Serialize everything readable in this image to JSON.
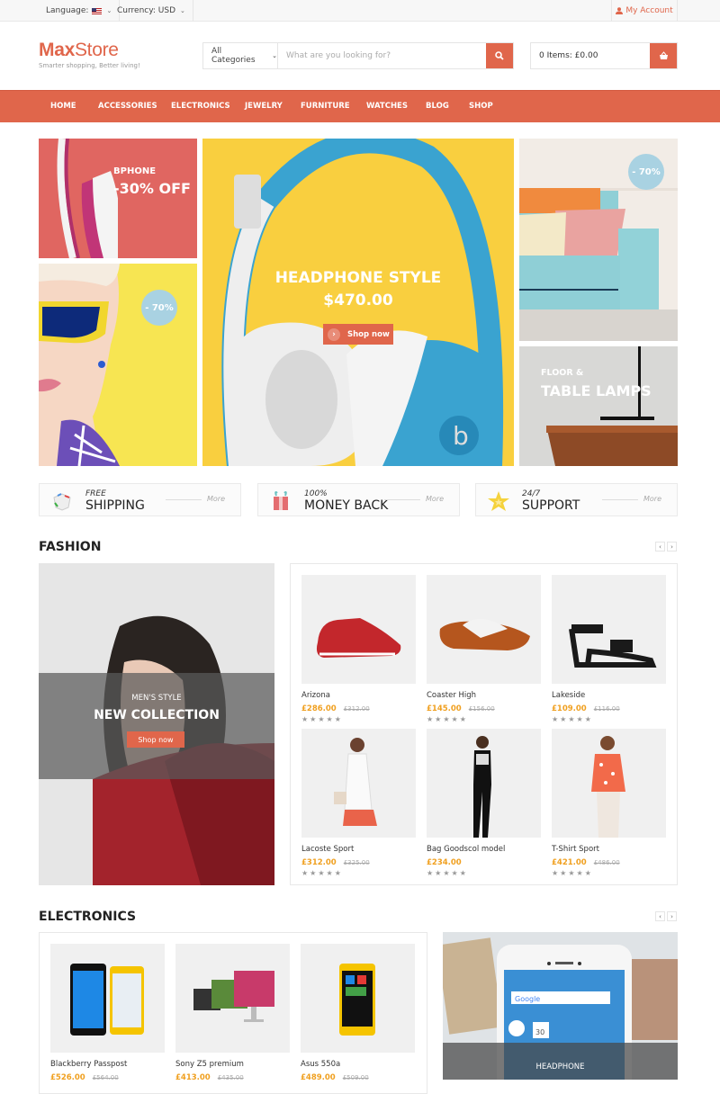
{
  "topbar": {
    "language_label": "Language:",
    "language_flag": "us-flag",
    "currency_label": "Currency: USD",
    "account_label": "My Account"
  },
  "header": {
    "logo_bold": "Max",
    "logo_rest": "Store",
    "tagline": "Smarter shopping, Better living!",
    "category_select": "All Categories",
    "search_placeholder": "What are you looking for?",
    "search_value": "",
    "cart_label": "0 Items: £0.00"
  },
  "nav": {
    "items": [
      "HOME",
      "ACCESSORIES",
      "ELECTRONICS",
      "JEWELRY",
      "FURNITURE",
      "WATCHES",
      "BLOG",
      "SHOP"
    ]
  },
  "banners": {
    "bphone": {
      "title": "BPHONE",
      "discount": "-30",
      "suffix": "% OFF"
    },
    "sunglasses": {
      "badge": "- 70%"
    },
    "main": {
      "title": "HEADPHONE STYLE",
      "price": "$470.00",
      "button": "Shop now"
    },
    "sofa": {
      "badge": "- 70%"
    },
    "lamps": {
      "line1": "FLOOR &",
      "line2": "TABLE LAMPS"
    }
  },
  "features": [
    {
      "small": "FREE",
      "big": "SHIPPING",
      "more": "More",
      "icon": "box-icon"
    },
    {
      "small": "100%",
      "big": "MONEY BACK",
      "more": "More",
      "icon": "gift-icon"
    },
    {
      "small": "24/7",
      "big": "SUPPORT",
      "more": "More",
      "icon": "star-icon"
    }
  ],
  "fashion": {
    "title": "FASHION",
    "promo": {
      "subtitle": "MEN'S STYLE",
      "title": "NEW COLLECTION",
      "button": "Shop now"
    },
    "products": [
      {
        "name": "Arizona",
        "price": "£286.00",
        "old_price": "£312.00",
        "rating": 0
      },
      {
        "name": "Coaster High",
        "price": "£145.00",
        "old_price": "£156.00",
        "rating": 0
      },
      {
        "name": "Lakeside",
        "price": "£109.00",
        "old_price": "£116.00",
        "rating": 0
      },
      {
        "name": "Lacoste Sport",
        "price": "£312.00",
        "old_price": "£325.00",
        "rating": 0
      },
      {
        "name": "Bag Goodscol model",
        "price": "£234.00",
        "old_price": "",
        "rating": 0
      },
      {
        "name": "T-Shirt Sport",
        "price": "£421.00",
        "old_price": "£486.00",
        "rating": 0
      }
    ]
  },
  "electronics": {
    "title": "ELECTRONICS",
    "promo": {
      "label": "HEADPHONE"
    },
    "products": [
      {
        "name": "Blackberry Passpost",
        "price": "£526.00",
        "old_price": "£564.00"
      },
      {
        "name": "Sony Z5 premium",
        "price": "£413.00",
        "old_price": "£435.00"
      },
      {
        "name": "Asus 550a",
        "price": "£489.00",
        "old_price": "£509.00"
      }
    ]
  },
  "carousel": {
    "prev": "‹",
    "next": "›"
  },
  "stars": "★★★★★"
}
